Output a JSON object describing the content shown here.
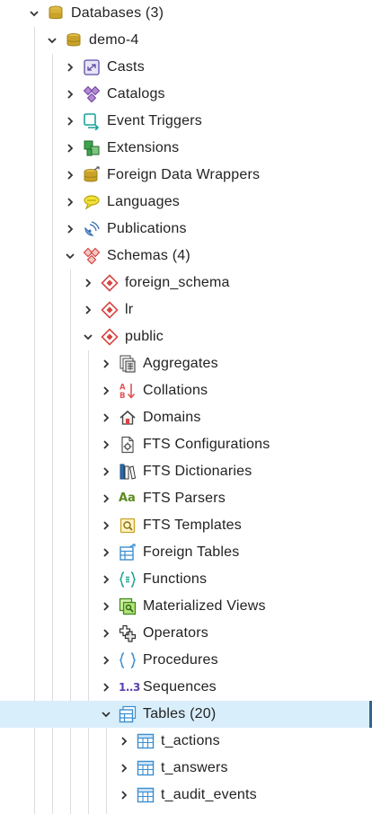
{
  "tree": {
    "databases": {
      "label": "Databases (3)"
    },
    "demo": {
      "label": "demo-4"
    },
    "casts": {
      "label": "Casts"
    },
    "catalogs": {
      "label": "Catalogs"
    },
    "event_triggers": {
      "label": "Event Triggers"
    },
    "extensions": {
      "label": "Extensions"
    },
    "fdw": {
      "label": "Foreign Data Wrappers"
    },
    "languages": {
      "label": "Languages"
    },
    "publications": {
      "label": "Publications"
    },
    "schemas": {
      "label": "Schemas (4)"
    },
    "foreign_schema": {
      "label": "foreign_schema"
    },
    "lr": {
      "label": "lr"
    },
    "public": {
      "label": "public"
    },
    "aggregates": {
      "label": "Aggregates"
    },
    "collations": {
      "label": "Collations"
    },
    "domains": {
      "label": "Domains"
    },
    "fts_configurations": {
      "label": "FTS Configurations"
    },
    "fts_dictionaries": {
      "label": "FTS Dictionaries"
    },
    "fts_parsers": {
      "label": "FTS Parsers",
      "icon_text": "Aa"
    },
    "fts_templates": {
      "label": "FTS Templates"
    },
    "foreign_tables": {
      "label": "Foreign Tables"
    },
    "functions": {
      "label": "Functions"
    },
    "materialized_views": {
      "label": "Materialized Views"
    },
    "operators": {
      "label": "Operators"
    },
    "procedures": {
      "label": "Procedures"
    },
    "sequences": {
      "label": "Sequences",
      "icon_text": "1..3"
    },
    "tables": {
      "label": "Tables (20)"
    },
    "t_actions": {
      "label": "t_actions"
    },
    "t_answers": {
      "label": "t_answers"
    },
    "t_audit_events": {
      "label": "t_audit_events"
    }
  },
  "colors": {
    "selection_bg": "#d9eefb",
    "selection_edge": "#326690",
    "schema_red": "#d64541",
    "table_blue": "#3b8ed0",
    "db_gold": "#c9a227"
  }
}
